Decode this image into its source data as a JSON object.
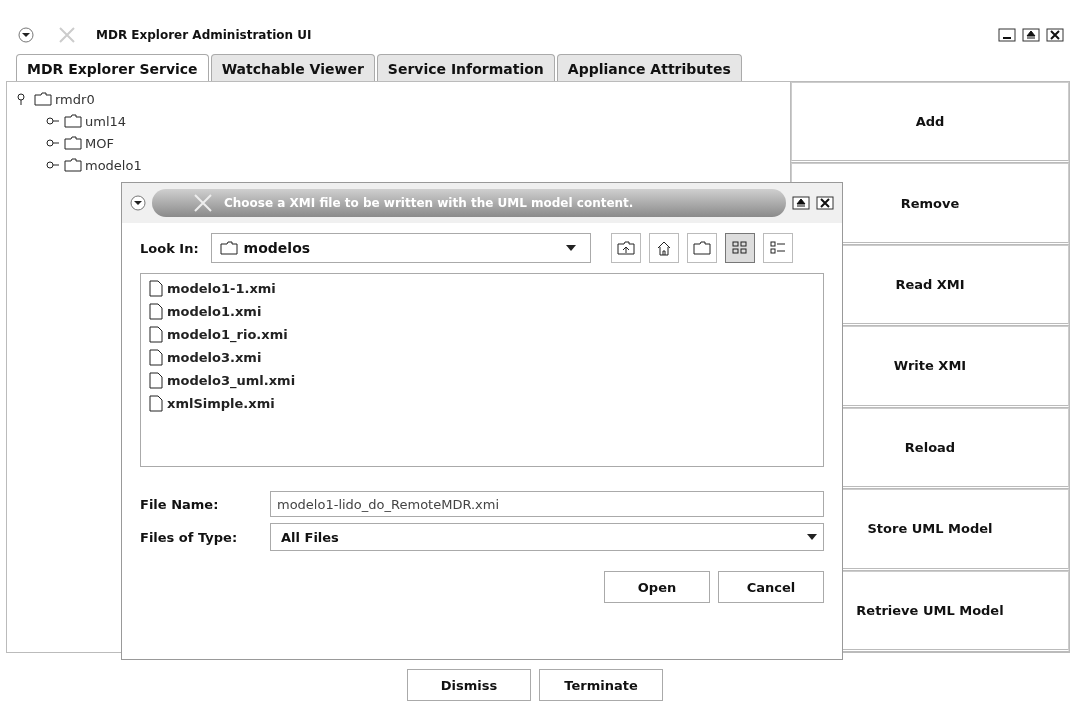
{
  "window": {
    "title": "MDR Explorer Administration UI"
  },
  "tabs": [
    {
      "label": "MDR Explorer Service",
      "selected": true
    },
    {
      "label": "Watchable Viewer",
      "selected": false
    },
    {
      "label": "Service Information",
      "selected": false
    },
    {
      "label": "Appliance Attributes",
      "selected": false
    }
  ],
  "tree": [
    {
      "label": "rmdr0",
      "expanded": true,
      "children": [
        {
          "label": "uml14",
          "expanded": false
        },
        {
          "label": "MOF",
          "expanded": false
        },
        {
          "label": "modelo1",
          "expanded": false
        }
      ]
    }
  ],
  "side_buttons": [
    "Add",
    "Remove",
    "Read XMI",
    "Write XMI",
    "Reload",
    "Store UML Model",
    "Retrieve UML Model"
  ],
  "dialog": {
    "title": "Choose a XMI file to be written with the UML model content.",
    "look_in": {
      "label": "Look In:",
      "value": "modelos"
    },
    "view_buttons": [
      {
        "kind": "list",
        "selected": true
      },
      {
        "kind": "details",
        "selected": false
      }
    ],
    "files": [
      "modelo1-1.xmi",
      "modelo1.xmi",
      "modelo1_rio.xmi",
      "modelo3.xmi",
      "modelo3_uml.xmi",
      "xmlSimple.xmi"
    ],
    "file_name": {
      "label": "File Name:",
      "value": "modelo1-lido_do_RemoteMDR.xmi"
    },
    "file_type": {
      "label": "Files of Type:",
      "value": "All Files"
    },
    "buttons": [
      "Open",
      "Cancel"
    ]
  },
  "bottom_buttons": [
    "Dismiss",
    "Terminate"
  ]
}
